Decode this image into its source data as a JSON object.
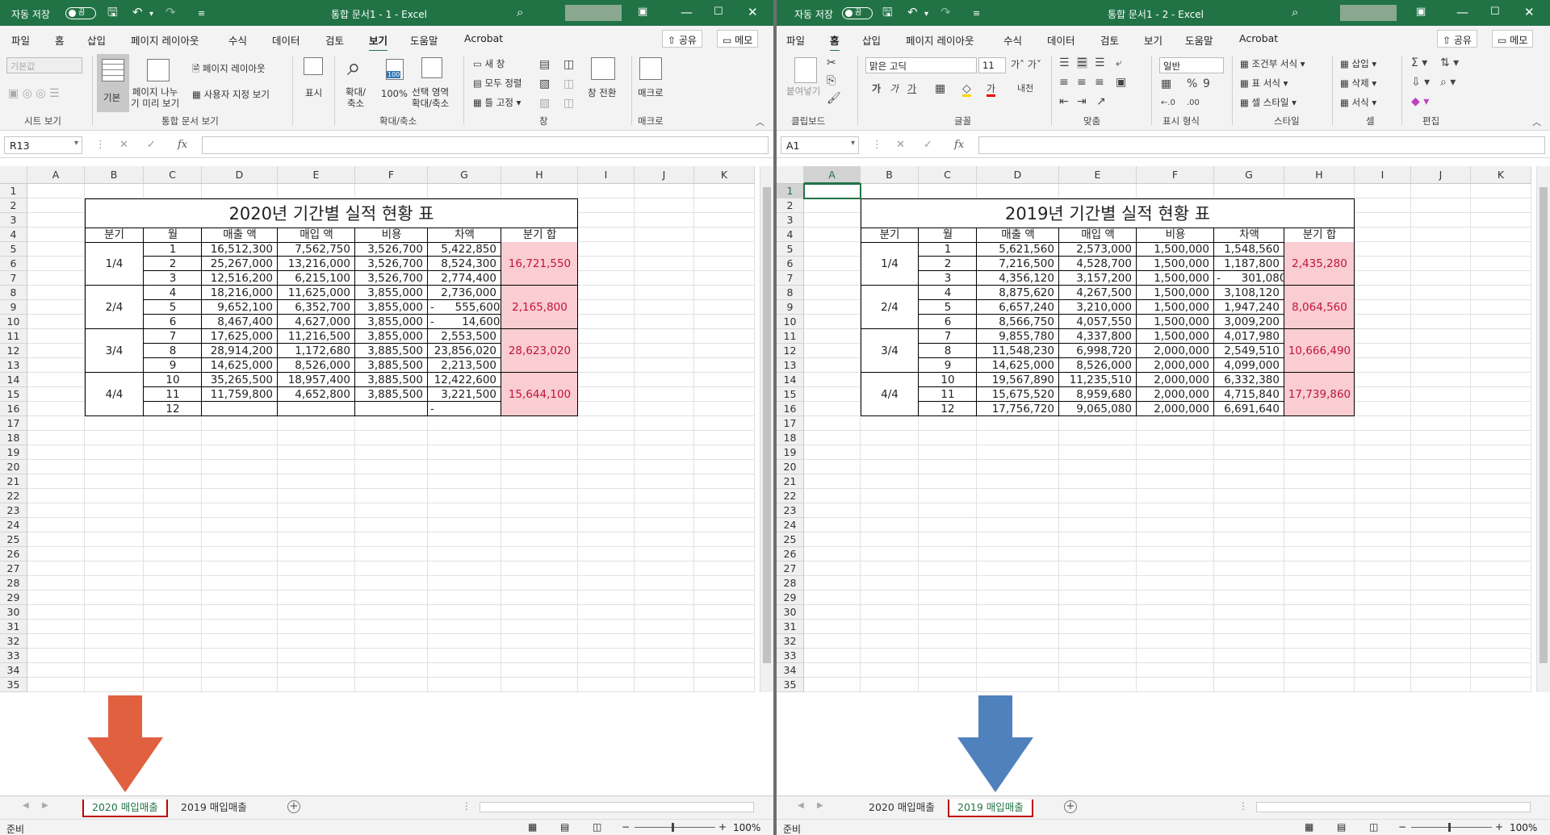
{
  "windows": [
    {
      "autosave_label": "자동 저장",
      "autosave_state": "끔",
      "title": "통합 문서1 - 1 - Excel",
      "menu": [
        "파일",
        "홈",
        "삽입",
        "페이지 레이아웃",
        "수식",
        "데이터",
        "검토",
        "보기",
        "도움말",
        "Acrobat"
      ],
      "active_menu": "보기",
      "share_label": "공유",
      "memo_label": "메모",
      "namebox": "R13",
      "ribbon": {
        "style_box": "기본값",
        "normal_label": "기본",
        "pagebreak_label": "페이지 나누\n기 미리 보기",
        "pagelayout_label": "페이지 레이아웃",
        "custom_view_label": "사용자 지정 보기",
        "show_label": "표시",
        "zoom_label": "확대/\n축소",
        "zoom100_label": "100%",
        "zoomsel_label": "선택 영역\n확대/축소",
        "newwin_label": "새 창",
        "arrange_label": "모두 정렬",
        "freeze_label": "틀 고정",
        "switch_label": "창 전환",
        "macro_label": "매크로",
        "group_sheetview": "시트 보기",
        "group_workbookview": "통합 문서 보기",
        "group_zoom": "확대/축소",
        "group_window": "창",
        "group_macro": "매크로"
      },
      "columns": [
        "A",
        "B",
        "C",
        "D",
        "E",
        "F",
        "G",
        "H",
        "I",
        "J",
        "K"
      ],
      "table": {
        "title": "2020년 기간별 실적 현황 표",
        "headers": [
          "분기",
          "월",
          "매출 액",
          "매입 액",
          "비용",
          "차액",
          "분기 합"
        ],
        "quarters": [
          "1/4",
          "2/4",
          "3/4",
          "4/4"
        ],
        "quarter_sums": [
          "16,721,550",
          "2,165,800",
          "28,623,020",
          "15,644,100"
        ],
        "rows": [
          [
            "1",
            "16,512,300",
            "7,562,750",
            "3,526,700",
            "5,422,850"
          ],
          [
            "2",
            "25,267,000",
            "13,216,000",
            "3,526,700",
            "8,524,300"
          ],
          [
            "3",
            "12,516,200",
            "6,215,100",
            "3,526,700",
            "2,774,400"
          ],
          [
            "4",
            "18,216,000",
            "11,625,000",
            "3,855,000",
            "2,736,000"
          ],
          [
            "5",
            "9,652,100",
            "6,352,700",
            "3,855,000",
            "-      555,600"
          ],
          [
            "6",
            "8,467,400",
            "4,627,000",
            "3,855,000",
            "-        14,600"
          ],
          [
            "7",
            "17,625,000",
            "11,216,500",
            "3,855,000",
            "2,553,500"
          ],
          [
            "8",
            "28,914,200",
            "1,172,680",
            "3,885,500",
            "23,856,020"
          ],
          [
            "9",
            "14,625,000",
            "8,526,000",
            "3,885,500",
            "2,213,500"
          ],
          [
            "10",
            "35,265,500",
            "18,957,400",
            "3,885,500",
            "12,422,600"
          ],
          [
            "11",
            "11,759,800",
            "4,652,800",
            "3,885,500",
            "3,221,500"
          ],
          [
            "12",
            "",
            "",
            "",
            "-"
          ]
        ]
      },
      "tabs": [
        "2020 매입매출",
        "2019 매입매출"
      ],
      "active_tab": 0,
      "status": "준비",
      "zoom": "100%"
    },
    {
      "autosave_label": "자동 저장",
      "autosave_state": "끔",
      "title": "통합 문서1 - 2 - Excel",
      "menu": [
        "파일",
        "홈",
        "삽입",
        "페이지 레이아웃",
        "수식",
        "데이터",
        "검토",
        "보기",
        "도움말",
        "Acrobat"
      ],
      "active_menu": "홈",
      "share_label": "공유",
      "memo_label": "메모",
      "namebox": "A1",
      "ribbon": {
        "paste_label": "붙여넣기",
        "font_name": "맑은 고딕",
        "font_size": "11",
        "number_format": "일반",
        "cond_format": "조건부 서식",
        "table_format": "표 서식",
        "cell_style": "셀 스타일",
        "insert": "삽입",
        "delete": "삭제",
        "format": "서식",
        "group_clipboard": "클립보드",
        "group_font": "글꼴",
        "group_align": "맞춤",
        "group_number": "표시 형식",
        "group_style": "스타일",
        "group_cells": "셀",
        "group_edit": "편집"
      },
      "columns": [
        "A",
        "B",
        "C",
        "D",
        "E",
        "F",
        "G",
        "H",
        "I",
        "J",
        "K"
      ],
      "table": {
        "title": "2019년 기간별 실적 현황 표",
        "headers": [
          "분기",
          "월",
          "매출 액",
          "매입 액",
          "비용",
          "차액",
          "분기 합"
        ],
        "quarters": [
          "1/4",
          "2/4",
          "3/4",
          "4/4"
        ],
        "quarter_sums": [
          "2,435,280",
          "8,064,560",
          "10,666,490",
          "17,739,860"
        ],
        "rows": [
          [
            "1",
            "5,621,560",
            "2,573,000",
            "1,500,000",
            "1,548,560"
          ],
          [
            "2",
            "7,216,500",
            "4,528,700",
            "1,500,000",
            "1,187,800"
          ],
          [
            "3",
            "4,356,120",
            "3,157,200",
            "1,500,000",
            "-      301,080"
          ],
          [
            "4",
            "8,875,620",
            "4,267,500",
            "1,500,000",
            "3,108,120"
          ],
          [
            "5",
            "6,657,240",
            "3,210,000",
            "1,500,000",
            "1,947,240"
          ],
          [
            "6",
            "8,566,750",
            "4,057,550",
            "1,500,000",
            "3,009,200"
          ],
          [
            "7",
            "9,855,780",
            "4,337,800",
            "1,500,000",
            "4,017,980"
          ],
          [
            "8",
            "11,548,230",
            "6,998,720",
            "2,000,000",
            "2,549,510"
          ],
          [
            "9",
            "14,625,000",
            "8,526,000",
            "2,000,000",
            "4,099,000"
          ],
          [
            "10",
            "19,567,890",
            "11,235,510",
            "2,000,000",
            "6,332,380"
          ],
          [
            "11",
            "15,675,520",
            "8,959,680",
            "2,000,000",
            "4,715,840"
          ],
          [
            "12",
            "17,756,720",
            "9,065,080",
            "2,000,000",
            "6,691,640"
          ]
        ]
      },
      "tabs": [
        "2020 매입매출",
        "2019 매입매출"
      ],
      "active_tab": 1,
      "status": "준비",
      "zoom": "100%"
    }
  ],
  "colors": {
    "excel_green": "#217346",
    "pink_fill": "#f9cdd1",
    "pink_text": "#c0143c",
    "arrow_left": "#e06040",
    "arrow_right": "#4f81bd",
    "tab_highlight": "#c00000"
  }
}
